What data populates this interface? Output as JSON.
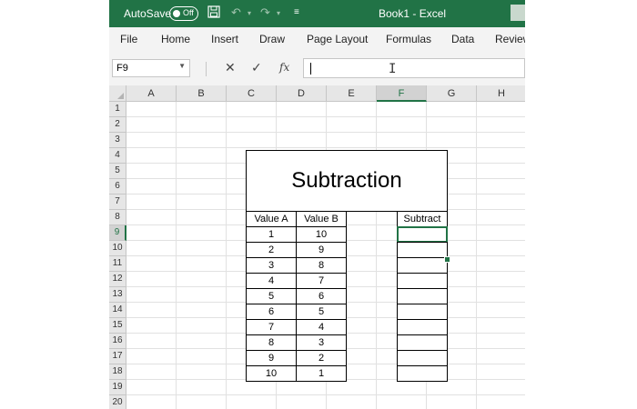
{
  "titlebar": {
    "autosave_label": "AutoSave",
    "autosave_state": "Off",
    "document_title": "Book1  -  Excel",
    "accent_color": "#217346"
  },
  "ribbon": {
    "tabs": [
      "File",
      "Home",
      "Insert",
      "Draw",
      "Page Layout",
      "Formulas",
      "Data",
      "Review"
    ]
  },
  "formula_bar": {
    "name_box": "F9",
    "cancel_icon": "✕",
    "enter_icon": "✓",
    "fx_label": "fx",
    "formula": ""
  },
  "sheet": {
    "columns": [
      "A",
      "B",
      "C",
      "D",
      "E",
      "F",
      "G",
      "H"
    ],
    "selected_column": "F",
    "rows": [
      "1",
      "2",
      "3",
      "4",
      "5",
      "6",
      "7",
      "8",
      "9",
      "10",
      "11",
      "12",
      "13",
      "14",
      "15",
      "16",
      "17",
      "18",
      "19",
      "20"
    ],
    "selected_row": "9",
    "title": "Subtraction",
    "value_a_header": "Value A",
    "value_b_header": "Value B",
    "subtract_header": "Subtract",
    "value_a": [
      "1",
      "2",
      "3",
      "4",
      "5",
      "6",
      "7",
      "8",
      "9",
      "10"
    ],
    "value_b": [
      "10",
      "9",
      "8",
      "7",
      "6",
      "5",
      "4",
      "3",
      "2",
      "1"
    ],
    "subtract": [
      "",
      "",
      "",
      "",
      "",
      "",
      "",
      "",
      "",
      ""
    ]
  }
}
